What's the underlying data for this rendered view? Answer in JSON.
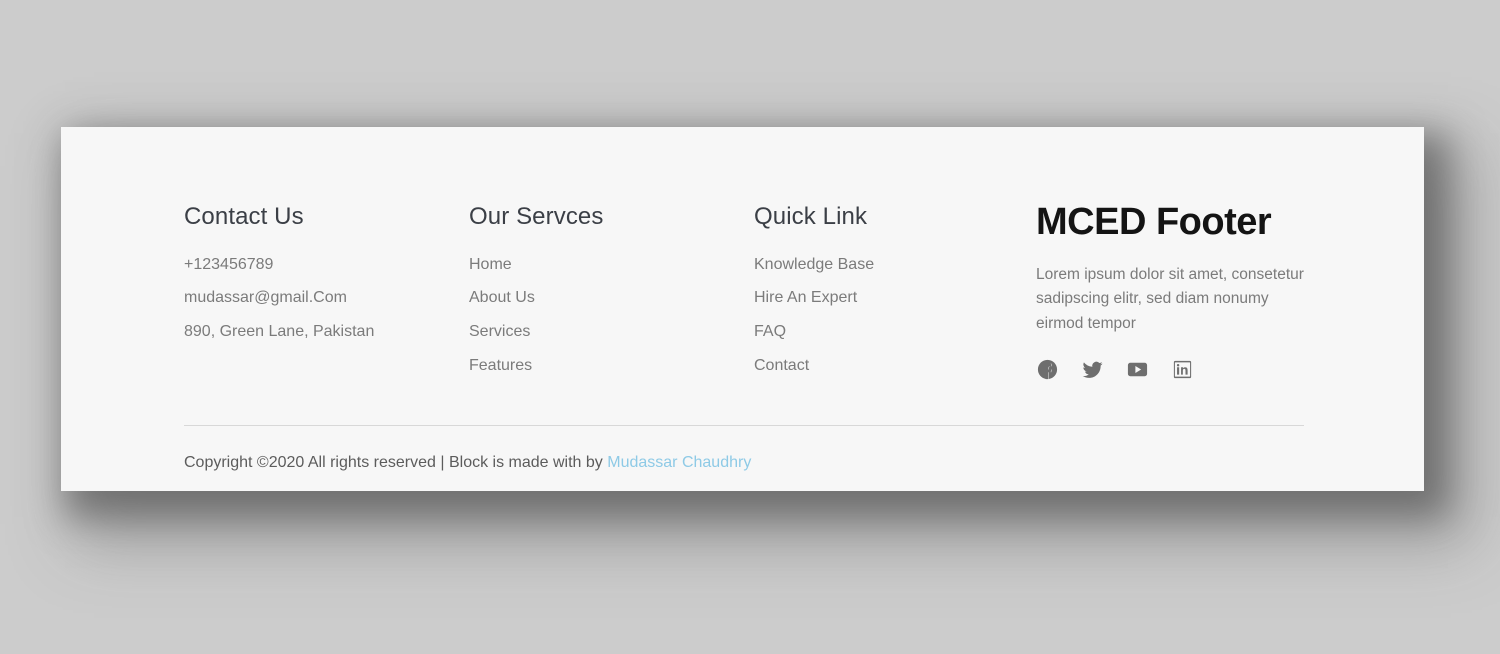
{
  "page": {
    "background_color": "#cccccc",
    "card_background_color": "#f7f7f7"
  },
  "columns": [
    {
      "id": "contact",
      "heading": "Contact Us",
      "items": [
        {
          "label": "+123456789",
          "type": "text"
        },
        {
          "label": "mudassar@gmail.Com",
          "type": "text"
        },
        {
          "label": "890, Green Lane, Pakistan",
          "type": "text"
        }
      ]
    },
    {
      "id": "services",
      "heading": "Our Servces",
      "items": [
        {
          "label": "Home",
          "type": "link"
        },
        {
          "label": "About Us",
          "type": "link"
        },
        {
          "label": "Services",
          "type": "link"
        },
        {
          "label": "Features",
          "type": "link"
        }
      ]
    },
    {
      "id": "quick",
      "heading": "Quick Link",
      "items": [
        {
          "label": "Knowledge Base",
          "type": "link"
        },
        {
          "label": "Hire An Expert",
          "type": "link"
        },
        {
          "label": "FAQ",
          "type": "link"
        },
        {
          "label": "Contact",
          "type": "link"
        }
      ]
    }
  ],
  "brand": {
    "title": "MCED Footer",
    "description": "Lorem ipsum dolor sit amet, consetetur sadipscing elitr, sed diam nonumy eirmod tempor",
    "social": [
      {
        "name": "facebook-icon",
        "label": "Facebook"
      },
      {
        "name": "twitter-icon",
        "label": "Twitter"
      },
      {
        "name": "youtube-icon",
        "label": "YouTube"
      },
      {
        "name": "linkedin-icon",
        "label": "LinkedIn"
      }
    ]
  },
  "copyright": {
    "text": "Copyright ©2020 All rights reserved | Block is made with by ",
    "author": "Mudassar Chaudhry",
    "author_color": "#8ecae6"
  },
  "colors": {
    "heading": "#3b3f46",
    "body_text": "#7b7b7b",
    "brand_title": "#141414",
    "divider": "#d8d8d8",
    "social_icon": "#6e6e6e"
  }
}
